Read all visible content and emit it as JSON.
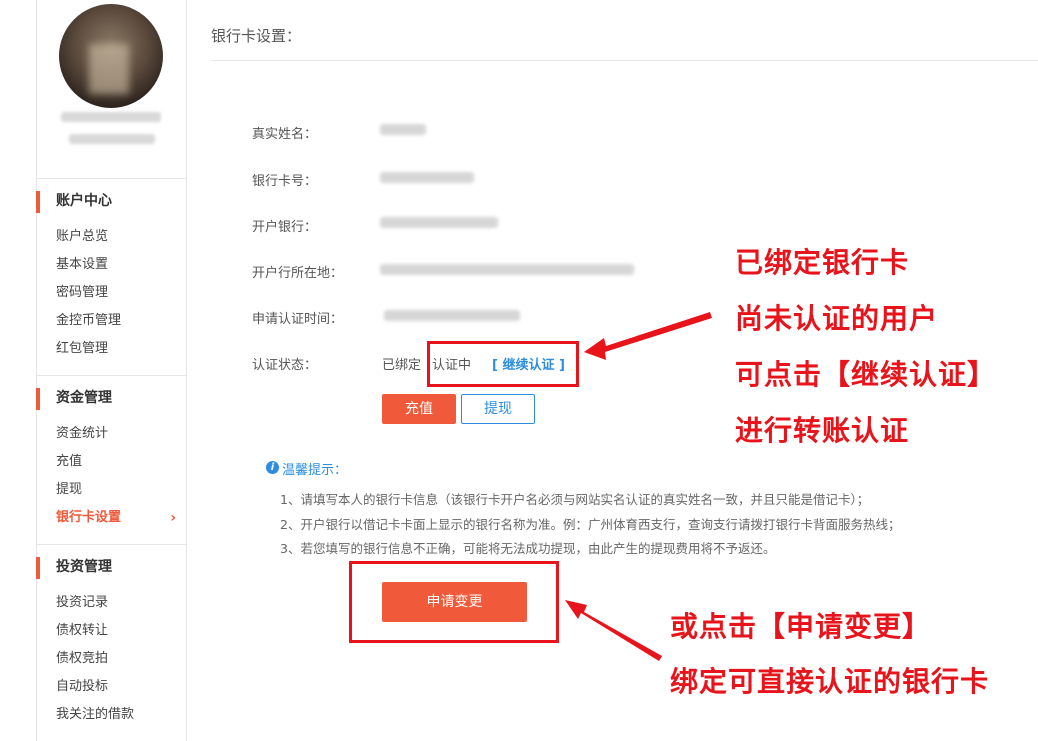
{
  "sidebar": {
    "sections": [
      {
        "title": "账户中心",
        "items": [
          "账户总览",
          "基本设置",
          "密码管理",
          "金控币管理",
          "红包管理"
        ]
      },
      {
        "title": "资金管理",
        "items": [
          "资金统计",
          "充值",
          "提现",
          "银行卡设置"
        ]
      },
      {
        "title": "投资管理",
        "items": [
          "投资记录",
          "债权转让",
          "债权竞拍",
          "自动投标",
          "我关注的借款"
        ]
      }
    ],
    "active_item": "银行卡设置"
  },
  "page": {
    "title": "银行卡设置：",
    "fields": {
      "real_name": "真实姓名：",
      "card_no": "银行卡号：",
      "bank": "开户银行：",
      "bank_location": "开户行所在地：",
      "apply_time": "申请认证时间：",
      "auth_status": "认证状态："
    },
    "status": {
      "bound": "已绑定",
      "verifying": "认证中",
      "continue_link": "[ 继续认证 ]"
    },
    "buttons": {
      "recharge": "充值",
      "withdraw": "提现",
      "apply_change": "申请变更"
    },
    "tips": {
      "title": "温馨提示：",
      "lines": [
        "1、请填写本人的银行卡信息（该银行卡开户名必须与网站实名认证的真实姓名一致，并且只能是借记卡）；",
        "2、开户银行以借记卡卡面上显示的银行名称为准。例：广州体育西支行，查询支行请拨打银行卡背面服务热线；",
        "3、若您填写的银行信息不正确，可能将无法成功提现，由此产生的提现费用将不予返还。"
      ]
    }
  },
  "annotations": {
    "top": [
      "已绑定银行卡",
      "尚未认证的用户",
      "可点击【继续认证】",
      "进行转账认证"
    ],
    "bottom": [
      "或点击【申请变更】",
      "绑定可直接认证的银行卡"
    ]
  },
  "colors": {
    "accent": "#f05a3a",
    "link": "#2d8ee0",
    "annotation": "#e8141b"
  }
}
